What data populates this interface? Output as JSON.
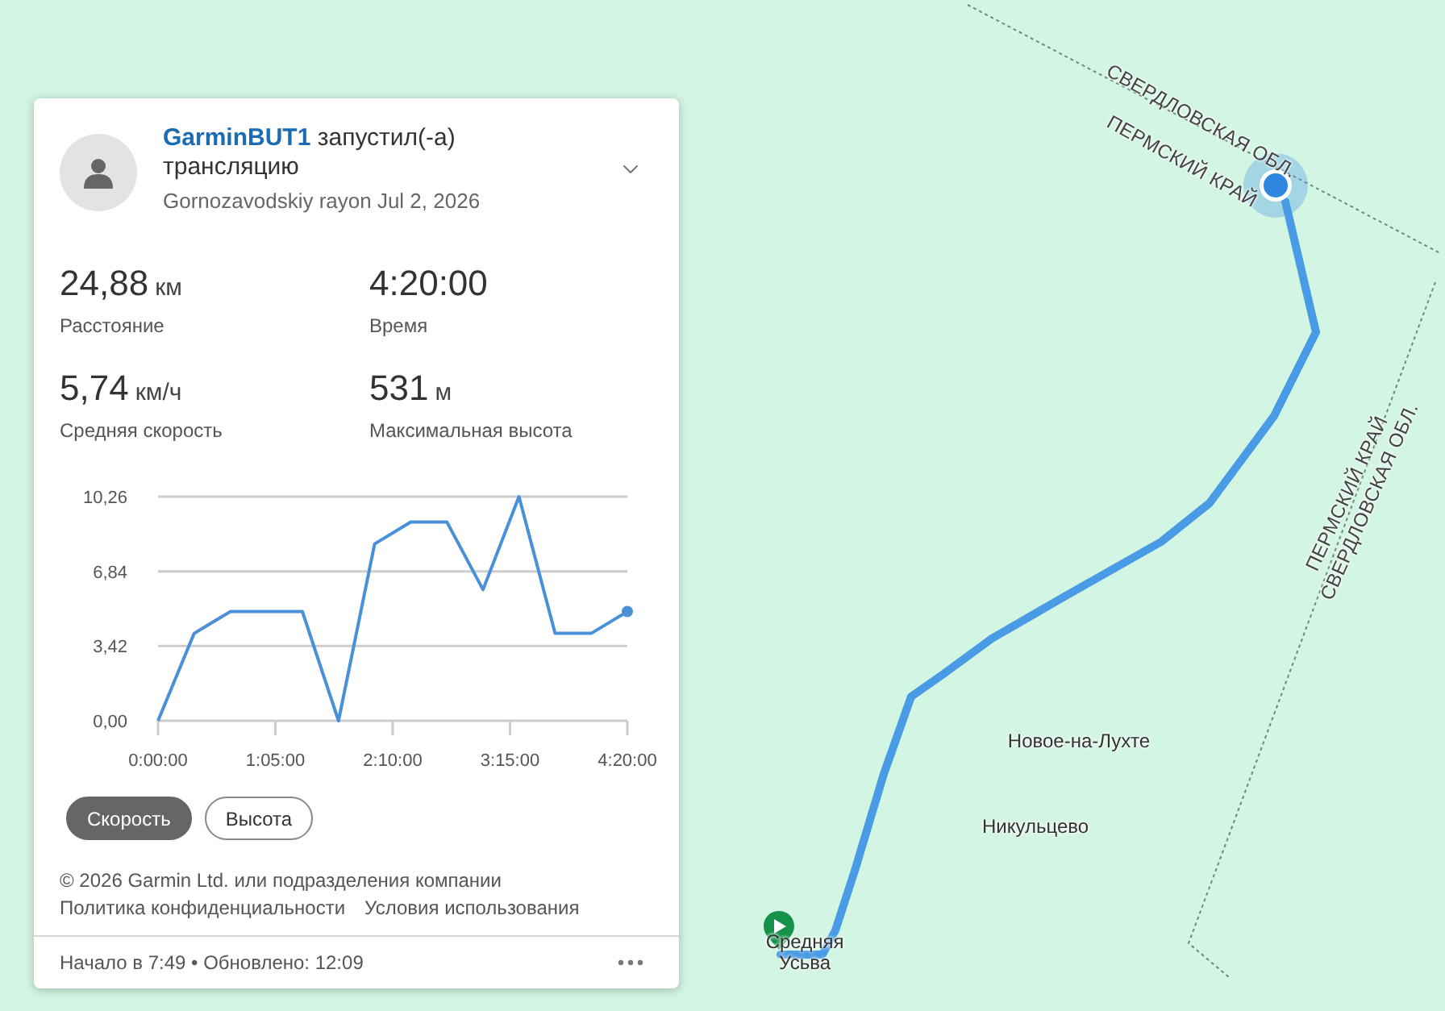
{
  "map": {
    "labels": [
      {
        "kind": "region",
        "text": "СВЕРДЛОВСКАЯ ОБЛ."
      },
      {
        "kind": "region",
        "text": "ПЕРМСКИЙ КРАЙ"
      },
      {
        "kind": "region",
        "text": "ПЕРМСКИЙ КРАЙ"
      },
      {
        "kind": "region",
        "text": "СВЕРДЛОВСКАЯ ОБЛ."
      },
      {
        "kind": "place",
        "text": "Новое-на-Лухте"
      },
      {
        "kind": "place",
        "text": "Никульцево"
      },
      {
        "kind": "place",
        "text": "Средняя Усьва"
      }
    ]
  },
  "card": {
    "title": "**GarminBUT1** запустил(-а) трансляцию",
    "subtitle": "Gornozavodskiy rayon Jul 2, 2026",
    "stats": [
      {
        "value": "24,88",
        "unit": "км",
        "label": "Расстояние"
      },
      {
        "value": "4:20:00",
        "label": "Время"
      },
      {
        "value": "5,74",
        "unit": "км/ч",
        "label": "Средняя скорость"
      },
      {
        "value": "531",
        "unit": "м",
        "label": "Максимальная высота"
      }
    ],
    "chart_data": {
      "type": "line",
      "x": [
        0,
        20,
        40,
        60,
        80,
        100,
        120,
        140,
        160,
        180,
        200,
        220,
        240,
        260
      ],
      "values": [
        0,
        4.0,
        5.0,
        5.0,
        5.0,
        0,
        8.1,
        9.1,
        9.1,
        6.0,
        10.26,
        4.0,
        4.0,
        5.0
      ],
      "xlim": [
        0,
        260
      ],
      "ylim": [
        0,
        10.26
      ],
      "xticks": [
        {
          "value": 0,
          "label": "0:00:00"
        },
        {
          "value": 65,
          "label": "1:05:00"
        },
        {
          "value": 130,
          "label": "2:10:00"
        },
        {
          "value": 195,
          "label": "3:15:00"
        },
        {
          "value": 260,
          "label": "4:20:00"
        }
      ],
      "yticks": [
        {
          "value": 0,
          "label": "0,00"
        },
        {
          "value": 3.42,
          "label": "3,42"
        },
        {
          "value": 6.84,
          "label": "6,84"
        },
        {
          "value": 10.26,
          "label": "10,26"
        }
      ]
    },
    "chart_tabs": [
      {
        "label": "Скорость",
        "selected": true
      },
      {
        "label": "Высота",
        "selected": false
      }
    ],
    "copyright": "© 2026 Garmin Ltd. или подразделения компании",
    "links": [
      "Политика конфиденциальности",
      "Условия использования"
    ],
    "footer": "Начало в 7:49 • Обновлено: 12:09"
  }
}
